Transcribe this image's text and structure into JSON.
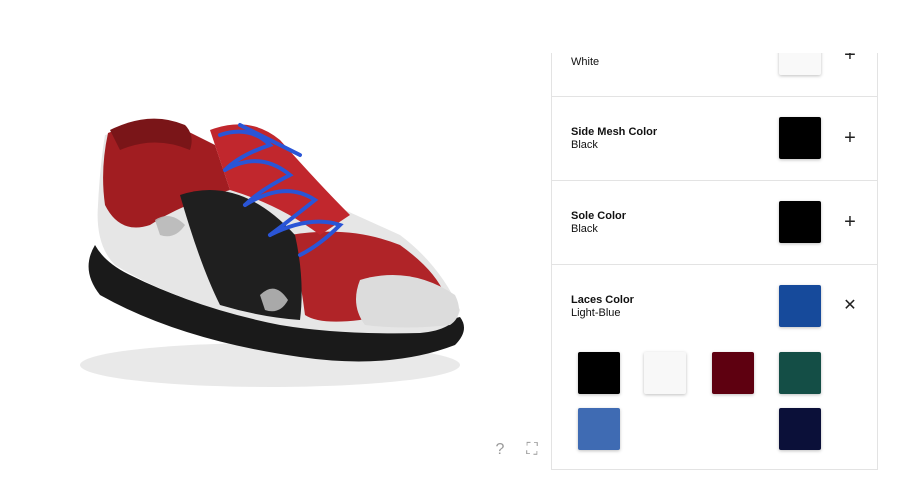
{
  "viewer": {
    "help_glyph": "?",
    "fullscreen_glyph": "⛶",
    "help_icon": "help-icon",
    "fullscreen_icon": "fullscreen-icon"
  },
  "options": [
    {
      "name": "",
      "value": "White",
      "color": "#f9f9f9",
      "toggle": "+"
    },
    {
      "name": "Side Mesh Color",
      "value": "Black",
      "color": "#000000",
      "toggle": "+"
    },
    {
      "name": "Sole Color",
      "value": "Black",
      "color": "#000000",
      "toggle": "+"
    },
    {
      "name": "Laces Color",
      "value": "Light-Blue",
      "color": "#164a9b",
      "toggle": "✕"
    }
  ],
  "lace_palette": [
    {
      "color": "#000000"
    },
    {
      "color": "#f8f8f8"
    },
    {
      "color": "#5e0010"
    },
    {
      "color": "#144e46"
    },
    {
      "color": "#3f6bb3"
    },
    {
      "color": "#0b1039"
    }
  ]
}
